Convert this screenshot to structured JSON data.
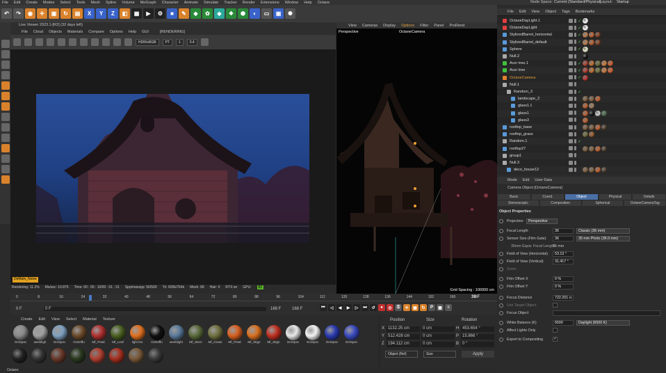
{
  "menu": [
    "File",
    "Edit",
    "Create",
    "Modes",
    "Select",
    "Tools",
    "Mesh",
    "Spline",
    "Volume",
    "MoGraph",
    "Character",
    "Animate",
    "Simulate",
    "Tracker",
    "Render",
    "Extensions",
    "Window",
    "Help",
    "Octane"
  ],
  "node_space": {
    "label": "Node Space:",
    "value": "Current (Standard/Physical)"
  },
  "layout": {
    "label": "Layout:",
    "value": "Startup"
  },
  "live_viewer": {
    "title": "Live Viewer 2023.1-[R2] (32 days left)",
    "menu": [
      "File",
      "Cloud",
      "Objects",
      "Materials",
      "Compare",
      "Options",
      "Help",
      "GUI"
    ],
    "status_tag": "[RENDERING]",
    "color_space": "HDR/sRGB",
    "mode": "PT",
    "value1": "1",
    "value2": "0.4",
    "status": [
      "Rendering: 11.2%",
      "Ms/sec: 10.875",
      "Time: 00 : 00 : 10/00 : 01 : 31",
      "Spp/maxspp: 56/500",
      "Tri: 600k/764k",
      "Mesh: 89",
      "Hair: 0",
      "RTX:on",
      "GPU:",
      "82"
    ],
    "overlay_tag": "DeMaln_Noise"
  },
  "viewport": {
    "menu": [
      "View",
      "Cameras",
      "Display",
      "Options",
      "Filter",
      "Panel",
      "ProRend"
    ],
    "label": "Perspective",
    "camera": "OctaneCamera",
    "grid_spacing": "Grid Spacing : 100000 cm"
  },
  "timeline": {
    "ticks": [
      "0",
      "8",
      "16",
      "24",
      "32",
      "40",
      "48",
      "56",
      "64",
      "72",
      "80",
      "88",
      "96",
      "104",
      "112",
      "120",
      "128",
      "136",
      "144",
      "152",
      "160",
      "168"
    ],
    "current_frame": "28 F",
    "start": "0 F",
    "start2": "0 F",
    "end": "168 F",
    "end2": "168 F"
  },
  "materials": {
    "menu": [
      "Create",
      "Edit",
      "View",
      "Select",
      "Material",
      "Texture"
    ],
    "row1": [
      {
        "label": "OctSpec",
        "color": "#8a8a8a"
      },
      {
        "label": "weekligh",
        "color": "#a0a0a0"
      },
      {
        "label": "OctSpec",
        "color": "#7fa0c0"
      },
      {
        "label": "OctDiffu",
        "color": "#6b4a2a"
      },
      {
        "label": "Mf_Petal",
        "color": "#b03030"
      },
      {
        "label": "Mf_Leaf",
        "color": "#4a6020"
      },
      {
        "label": "light les",
        "color": "#e07020"
      },
      {
        "label": "OctDiffu",
        "color": "#101010"
      },
      {
        "label": "weeklight",
        "color": "#5a7a9a"
      },
      {
        "label": "Mf_Stem",
        "color": "#5a6a3a"
      },
      {
        "label": "Mf_Grass",
        "color": "#707040"
      },
      {
        "label": "Mf_Petal",
        "color": "#d86020"
      },
      {
        "label": "Mf_Stign",
        "color": "#d87020"
      },
      {
        "label": "Mf_Stign",
        "color": "#c03020"
      },
      {
        "label": "OctSpec",
        "color": "#e8e8e8"
      },
      {
        "label": "OctSpec",
        "color": "#f4f4f4"
      },
      {
        "label": "OctSpec",
        "color": "#2a3ab0"
      },
      {
        "label": "OctSpec",
        "color": "#3a4ac0"
      }
    ],
    "row2": [
      "#222",
      "#333",
      "#6a3a2a",
      "#2a3a20",
      "#b04030",
      "#a83020",
      "#7a5a3a",
      "#3a3a3a"
    ]
  },
  "coords": {
    "headers": [
      "Position",
      "Size",
      "Rotation"
    ],
    "rows": [
      {
        "axis": "X",
        "pos": "1132.25 cm",
        "size": "0 cm",
        "rlabel": "H",
        "rot": "453.654 °"
      },
      {
        "axis": "Y",
        "pos": "512.428 cm",
        "size": "0 cm",
        "rlabel": "P",
        "rot": "15.866 °"
      },
      {
        "axis": "Z",
        "pos": "194.112 cm",
        "size": "0 cm",
        "rlabel": "B",
        "rot": "0 °"
      }
    ],
    "mode": "Object (Rel)",
    "size_mode": "Size",
    "apply": "Apply"
  },
  "object_manager": {
    "menu": [
      "File",
      "Edit",
      "View",
      "Object",
      "Tags",
      "Bookmarks"
    ],
    "rows": [
      {
        "name": "OctaneDayLight.1",
        "indent": 0,
        "icon": "#e04040",
        "check": true,
        "tags": [
          "#fff"
        ]
      },
      {
        "name": "OctaneDayLight",
        "indent": 0,
        "icon": "#e04040",
        "check": true,
        "tags": [
          "#fff"
        ]
      },
      {
        "name": "StylizedBarrel_horizontal",
        "indent": 0,
        "icon": "#5a9ad8",
        "check": true,
        "tags": [
          "#c08050",
          "#c06030",
          "#804020"
        ]
      },
      {
        "name": "StylizedBarrel_default",
        "indent": 0,
        "icon": "#5a9ad8",
        "check": true,
        "tags": [
          "#c08050",
          "#c06030",
          "#804020"
        ]
      },
      {
        "name": "Sphere",
        "indent": 0,
        "icon": "#5a9ad8",
        "check": true,
        "tags": [
          "#f0f0d0"
        ]
      },
      {
        "name": "Null.2",
        "indent": 0,
        "icon": "#aaa",
        "check": false,
        "tags": [
          "#101010"
        ]
      },
      {
        "name": "Acer tree.1",
        "indent": 0,
        "icon": "#40c040",
        "check": true,
        "tags": [
          "#b04030",
          "#c07030",
          "#707040",
          "#d08040",
          "#d06030"
        ]
      },
      {
        "name": "Acer tree",
        "indent": 0,
        "icon": "#40c040",
        "check": true,
        "tags": [
          "#b04030",
          "#c07030",
          "#707040",
          "#d08040",
          "#d06030"
        ]
      },
      {
        "name": "OctaneCamera",
        "indent": 0,
        "icon": "#e08030",
        "check": true,
        "tags": [
          "#c03030"
        ],
        "highlight": true
      },
      {
        "name": "Null.1",
        "indent": 0,
        "icon": "#aaa",
        "check": false,
        "tags": []
      },
      {
        "name": "Random_3",
        "indent": 1,
        "icon": "#aaa",
        "check": true,
        "tags": []
      },
      {
        "name": "landscape_2",
        "indent": 2,
        "icon": "#5a9ad8",
        "check": false,
        "tags": [
          "#806040",
          "#806040",
          "#c06030"
        ]
      },
      {
        "name": "glass1.1",
        "indent": 2,
        "icon": "#5a9ad8",
        "check": false,
        "tags": [
          "#c06030",
          "#a08060"
        ]
      },
      {
        "name": "glass1",
        "indent": 2,
        "icon": "#5a9ad8",
        "check": false,
        "tags": [
          "#c06030",
          "#101010",
          "#d0d0d0",
          "#507050"
        ]
      },
      {
        "name": "glass3",
        "indent": 2,
        "icon": "#5a9ad8",
        "check": false,
        "tags": [
          "#c06030"
        ]
      },
      {
        "name": "rooftop_base",
        "indent": 0,
        "icon": "#5a9ad8",
        "check": false,
        "tags": [
          "#806040",
          "#806040",
          "#c06030",
          "#504030"
        ]
      },
      {
        "name": "rooftop_grass",
        "indent": 0,
        "icon": "#5a9ad8",
        "check": false,
        "tags": [
          "#707040",
          "#a06030"
        ]
      },
      {
        "name": "Random.1",
        "indent": 0,
        "icon": "#aaa",
        "check": true,
        "tags": []
      },
      {
        "name": "rooftop27",
        "indent": 0,
        "icon": "#5a9ad8",
        "check": false,
        "tags": [
          "#806040",
          "#806040",
          "#c06030",
          "#504030"
        ]
      },
      {
        "name": "group1",
        "indent": 0,
        "icon": "#aaa",
        "check": false,
        "tags": []
      },
      {
        "name": "Null.3",
        "indent": 0,
        "icon": "#aaa",
        "check": false,
        "tags": []
      },
      {
        "name": "deco_house12",
        "indent": 1,
        "icon": "#5a9ad8",
        "check": false,
        "tags": [
          "#806040",
          "#806040",
          "#c06030",
          "#504030"
        ]
      }
    ]
  },
  "attributes": {
    "menu": [
      "Mode",
      "Edit",
      "User Data"
    ],
    "object": "Camera Object [OctaneCamera]",
    "tabs_row1": [
      "Basic",
      "Coord.",
      "Object",
      "Physical",
      "Details"
    ],
    "tabs_row2": [
      "Stereoscopic",
      "Composition",
      "Spherical",
      "OctaneCameraTag"
    ],
    "active_tab": "Object",
    "section": "Object Properties",
    "props": [
      {
        "label": "Projection",
        "val": "",
        "sel": "Perspective",
        "dot": true,
        "short_sel": true
      },
      {
        "label": "Focal Length",
        "val": "36",
        "sel": "Classic (36 mm)",
        "dot": true
      },
      {
        "label": "Sensor Size (Film Gate)",
        "val": "36",
        "sel": "35 mm Photo (36.0 mm)",
        "dot": true
      },
      {
        "label": "35mm Equiv. Focal Length:",
        "val": "36 mm",
        "sel": "",
        "dot": false,
        "plain": true
      },
      {
        "label": "Field of View (Horizontal)",
        "val": "53.13 °",
        "sel": "",
        "dot": true
      },
      {
        "label": "Field of View (Vertical)",
        "val": "31.417 °",
        "sel": "",
        "dot": true
      },
      {
        "label": "Zoom",
        "val": "",
        "sel": "",
        "dot": true,
        "dim": true
      },
      {
        "label": "Film Offset X",
        "val": "0 %",
        "sel": "",
        "dot": true
      },
      {
        "label": "Film Offset Y",
        "val": "0 %",
        "sel": "",
        "dot": true
      },
      {
        "label": "Focus Distance",
        "val": "722.201 cı",
        "sel": "",
        "dot": true
      },
      {
        "label": "Use Target Object",
        "val": "",
        "sel": "",
        "dot": true,
        "dim": true
      },
      {
        "label": "Focus Object",
        "val": "",
        "sel": "",
        "dot": true
      },
      {
        "label": "White Balance (K)",
        "val": "6500",
        "sel": "Daylight (6500 K)",
        "dot": true
      },
      {
        "label": "Affect Lights Only",
        "val": "",
        "sel": "",
        "dot": true
      },
      {
        "label": "Export to Compositing",
        "val": "",
        "sel": "",
        "dot": true,
        "checked": true
      }
    ]
  },
  "status_bar": "Octane:"
}
